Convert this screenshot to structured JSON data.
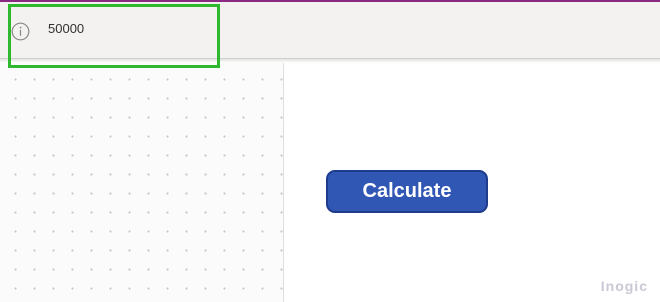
{
  "formula_bar": {
    "icon": "info-icon",
    "value": "50000"
  },
  "canvas": {
    "calculate_button_label": "Calculate"
  },
  "watermark": "Inogic",
  "colors": {
    "button_fill": "#3157b5",
    "button_border": "#1e3b8c",
    "highlight": "#2db82d",
    "top_accent": "#8b2a82"
  }
}
